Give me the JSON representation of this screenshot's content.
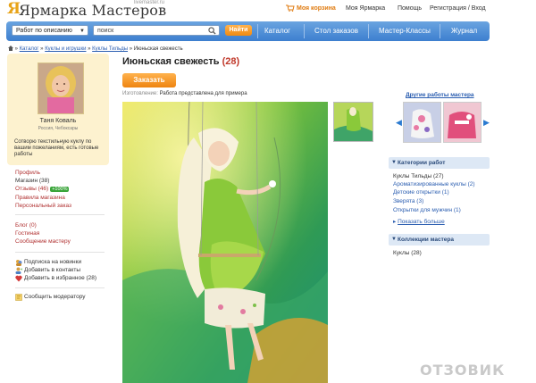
{
  "header": {
    "logo_mark": "Я",
    "logo_text": "Ярмарка Мастеров",
    "logo_sub": "livemaster.ru",
    "cart": "Моя корзина",
    "my_fair": "Моя Ярмарка",
    "help": "Помощь",
    "register_login": "Регистрация / Вход"
  },
  "searchbar": {
    "filter_value": "Работ по описанию",
    "search_value": "поиск",
    "go_label": "Найти",
    "nav": [
      "Каталог",
      "Стол заказов",
      "Мастер-Классы",
      "Журнал"
    ]
  },
  "breadcrumb": {
    "items": [
      "Каталог",
      "Куклы и игрушки",
      "Куклы Тильды"
    ],
    "current": "Июньская свежесть",
    "sep": "»"
  },
  "profile": {
    "name": "Таня Коваль",
    "location": "Россия, Чебоксары",
    "description": "Сотворю текстильную куклу по вашим пожеланиям, есть готовые работы"
  },
  "links": {
    "profile": "Профиль",
    "shop": "Магазин (38)",
    "reviews": "Отзывы (46)",
    "reviews_badge": "+100%",
    "shop_rules": "Правила магазина",
    "personal_order": "Персональный заказ",
    "blog": "Блог (0)",
    "guestbook": "Гостиная",
    "message": "Сообщение мастеру",
    "subscribe": "Подписка на новинки",
    "add_contacts": "Добавить в контакты",
    "add_favorites": "Добавить в избранное (28)",
    "report": "Сообщить модератору"
  },
  "product": {
    "title": "Июньская свежесть",
    "count": "(28)",
    "order_label": "Заказать",
    "made_label": "Изготовление:",
    "made_value": "Работа представлена для примера"
  },
  "right": {
    "other_works": "Другие работы мастера",
    "categories_header": "Категории работ",
    "categories": [
      {
        "label": "Куклы Тильды (27)",
        "link": false
      },
      {
        "label": "Ароматизированные куклы (2)",
        "link": true
      },
      {
        "label": "Детские открытки (1)",
        "link": true
      },
      {
        "label": "Зверята (3)",
        "link": true
      },
      {
        "label": "Открытки для мужчин (1)",
        "link": true
      }
    ],
    "show_more": "Показать больше",
    "collections_header": "Коллекции мастера",
    "collections": [
      "Куклы (28)"
    ]
  },
  "watermark": "ОТЗОВИК",
  "colors": {
    "accent_blue": "#3d7fcf",
    "orange": "#f08a12",
    "profile_bg": "#fdf2cf",
    "link_red": "#b03030",
    "badge_green": "#3aa53a"
  }
}
